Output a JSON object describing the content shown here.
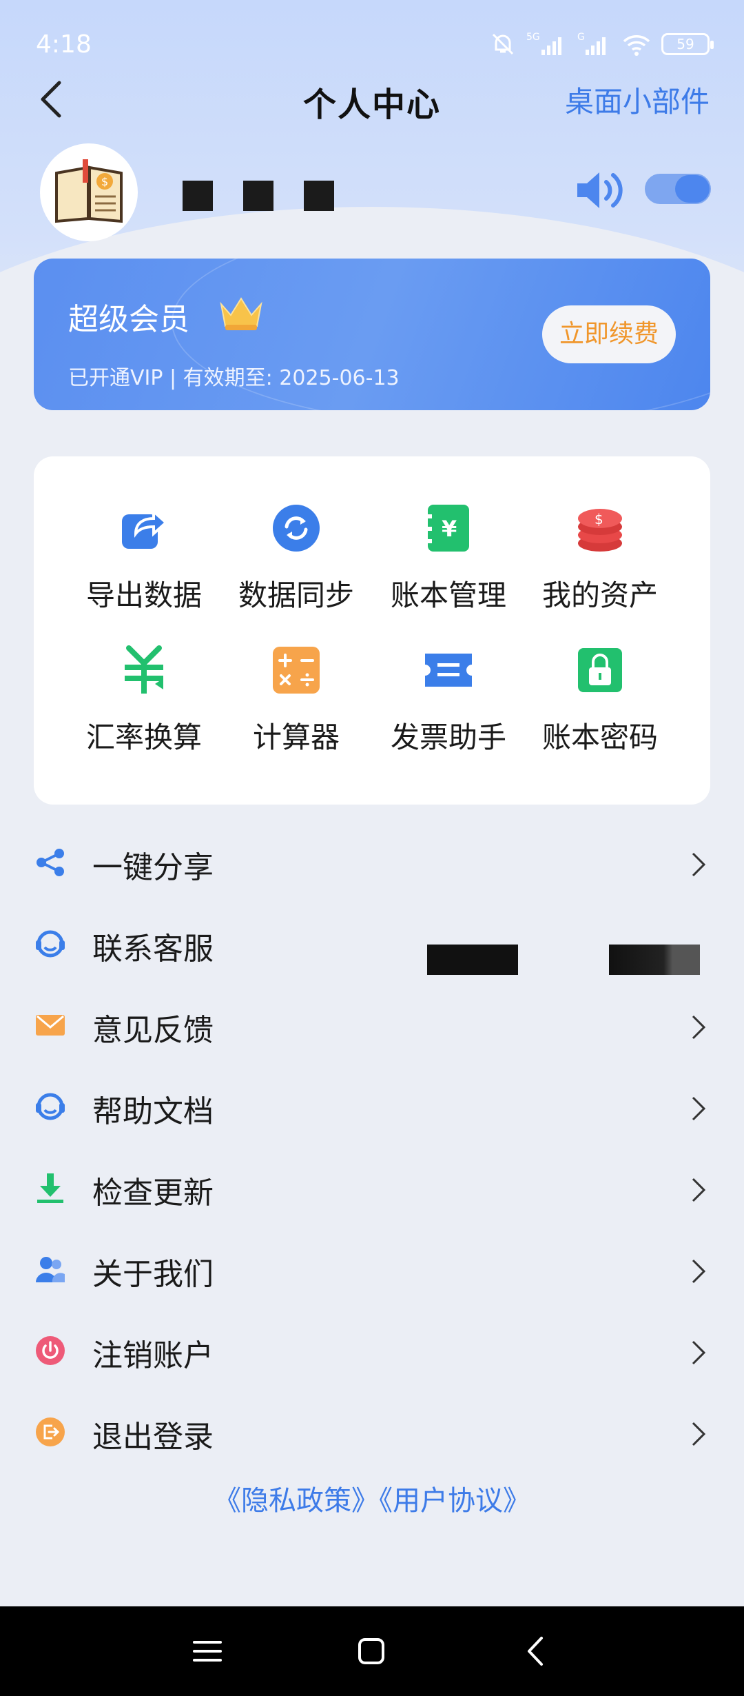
{
  "status": {
    "time": "4:18",
    "battery": "59",
    "network1": "5G",
    "network2": "G"
  },
  "header": {
    "title": "个人中心",
    "widget_link": "桌面小部件"
  },
  "vip": {
    "title": "超级会员",
    "subtitle": "已开通VIP | 有效期至: 2025-06-13",
    "renew_label": "立即续费"
  },
  "grid": [
    {
      "label": "导出数据",
      "icon": "export-icon",
      "color": "#3b7ee9"
    },
    {
      "label": "数据同步",
      "icon": "sync-icon",
      "color": "#3b7ee9"
    },
    {
      "label": "账本管理",
      "icon": "ledger-icon",
      "color": "#22c06e"
    },
    {
      "label": "我的资产",
      "icon": "coins-icon",
      "color": "#ec4a4a"
    },
    {
      "label": "汇率换算",
      "icon": "exchange-rate-icon",
      "color": "#22c06e"
    },
    {
      "label": "计算器",
      "icon": "calculator-icon",
      "color": "#f7a44b"
    },
    {
      "label": "发票助手",
      "icon": "invoice-icon",
      "color": "#3b7ee9"
    },
    {
      "label": "账本密码",
      "icon": "lock-icon",
      "color": "#22c06e"
    }
  ],
  "menu": [
    {
      "label": "一键分享",
      "icon": "share-icon",
      "color": "#3b7ee9"
    },
    {
      "label": "联系客服",
      "icon": "customer-service-icon",
      "color": "#3b7ee9"
    },
    {
      "label": "意见反馈",
      "icon": "mail-icon",
      "color": "#f7a44b"
    },
    {
      "label": "帮助文档",
      "icon": "help-icon",
      "color": "#3b7ee9"
    },
    {
      "label": "检查更新",
      "icon": "download-icon",
      "color": "#22c06e"
    },
    {
      "label": "关于我们",
      "icon": "people-icon",
      "color": "#3b7ee9"
    },
    {
      "label": "注销账户",
      "icon": "power-icon",
      "color": "#ee5a78"
    },
    {
      "label": "退出登录",
      "icon": "logout-icon",
      "color": "#f7a44b"
    }
  ],
  "footer": {
    "policy": "《隐私政策》《用户协议》"
  }
}
